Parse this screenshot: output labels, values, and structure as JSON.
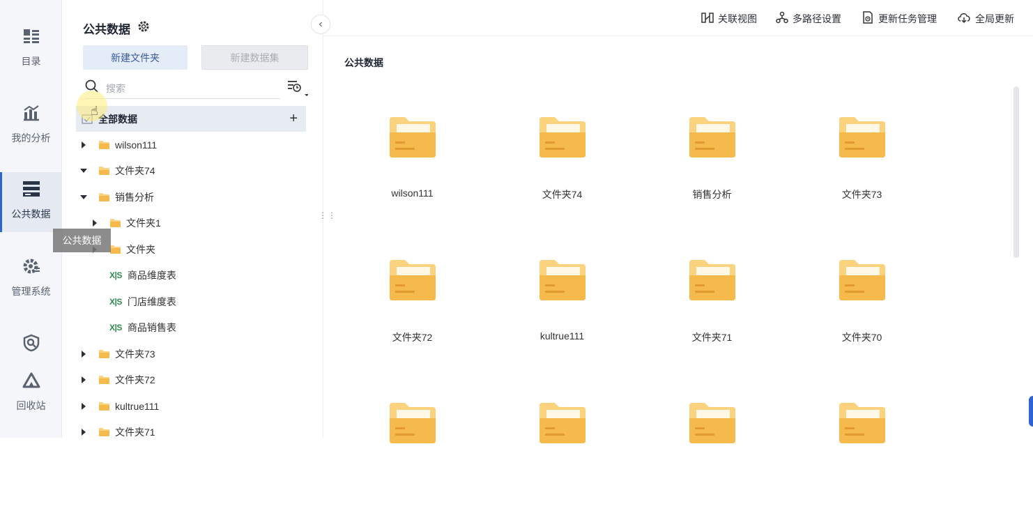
{
  "rail": {
    "items": [
      {
        "label": "目录",
        "icon": "catalog-icon"
      },
      {
        "label": "我的分析",
        "icon": "analysis-icon"
      },
      {
        "label": "公共数据",
        "icon": "public-data-icon"
      },
      {
        "label": "管理系统",
        "icon": "admin-gear-icon"
      },
      {
        "label": "",
        "icon": "shield-icon"
      },
      {
        "label": "回收站",
        "icon": "recycle-icon"
      }
    ],
    "tooltip": "公共数据"
  },
  "panel": {
    "title": "公共数据",
    "new_folder_label": "新建文件夹",
    "new_dataset_label": "新建数据集",
    "search_placeholder": "搜索",
    "root_label": "全部数据",
    "tree": [
      {
        "label": "wilson111",
        "type": "folder",
        "state": "collapsed",
        "level": 0
      },
      {
        "label": "文件夹74",
        "type": "folder-open",
        "state": "expanded",
        "level": 0
      },
      {
        "label": "销售分析",
        "type": "folder",
        "state": "expanded",
        "level": 0
      },
      {
        "label": "文件夹1",
        "type": "folder",
        "state": "collapsed",
        "level": 1
      },
      {
        "label": "文件夹",
        "type": "folder",
        "state": "collapsed",
        "level": 1
      },
      {
        "label": "商品维度表",
        "type": "xls",
        "state": "leaf",
        "level": 1
      },
      {
        "label": "门店维度表",
        "type": "xls",
        "state": "leaf",
        "level": 1
      },
      {
        "label": "商品销售表",
        "type": "xls",
        "state": "leaf",
        "level": 1
      },
      {
        "label": "文件夹73",
        "type": "folder",
        "state": "collapsed",
        "level": 0
      },
      {
        "label": "文件夹72",
        "type": "folder",
        "state": "collapsed",
        "level": 0
      },
      {
        "label": "kultrue111",
        "type": "folder",
        "state": "collapsed",
        "level": 0
      },
      {
        "label": "文件夹71",
        "type": "folder",
        "state": "collapsed",
        "level": 0
      }
    ],
    "xls_glyph": "X|S"
  },
  "toolbar": {
    "relation_view": "关联视图",
    "multipath_settings": "多路径设置",
    "update_task_mgmt": "更新任务管理",
    "global_update": "全局更新"
  },
  "main": {
    "title": "公共数据",
    "folders": [
      "wilson111",
      "文件夹74",
      "销售分析",
      "文件夹73",
      "文件夹72",
      "kultrue111",
      "文件夹71",
      "文件夹70",
      "",
      "",
      "",
      ""
    ]
  },
  "colors": {
    "accent": "#2c63d6",
    "folder": "#f6b94c",
    "folder_light": "#fbd27e",
    "xls": "#2e8b4e"
  }
}
